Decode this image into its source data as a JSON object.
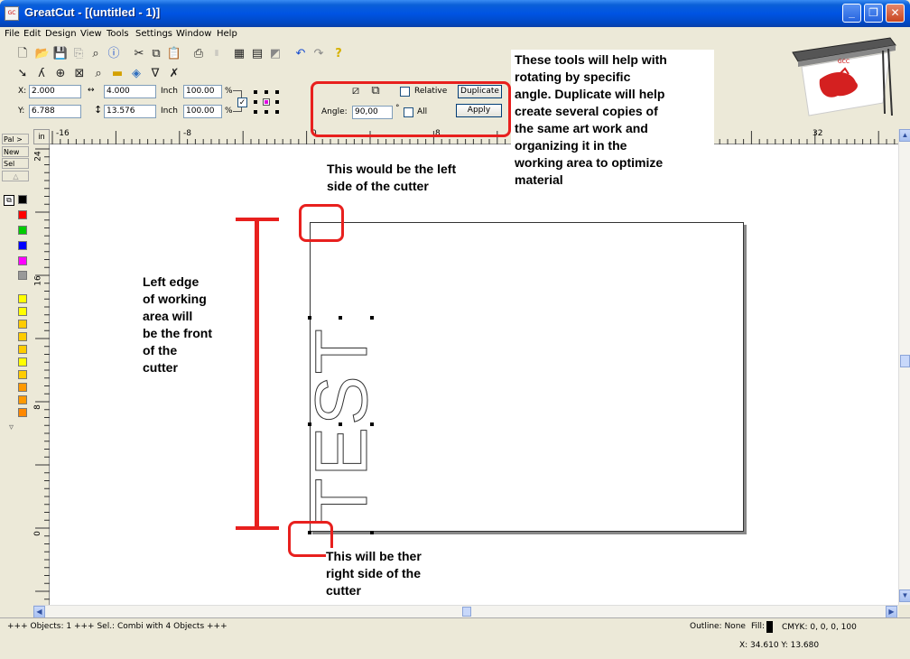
{
  "window": {
    "app_name": "GreatCut",
    "doc_title": " - [(untitled - 1)]",
    "icon_text": "GC"
  },
  "menu": [
    "File",
    "Edit",
    "Design",
    "View",
    "Tools",
    "Settings",
    "Window",
    "Help"
  ],
  "toolbar_icons": {
    "row1": [
      "new-file-icon",
      "open-folder-icon",
      "save-icon",
      "export-icon",
      "preview-icon",
      "info-icon",
      "cut-icon",
      "copy-icon",
      "paste-icon",
      "print-icon",
      "barcode-icon",
      "import-icon",
      "clipboard-icon",
      "erase-icon",
      "undo-icon",
      "redo-icon",
      "help-icon"
    ],
    "row2": [
      "pointer-icon",
      "node-edit-icon",
      "crosshair-icon",
      "frame-icon",
      "zoom-icon",
      "fill-bar-icon",
      "bucket-icon",
      "weld-icon",
      "knife-icon"
    ]
  },
  "props": {
    "x_label": "X:",
    "x_value": "2.000",
    "y_label": "Y:",
    "y_value": "6.788",
    "width_value": "4.000",
    "height_value": "13.576",
    "unit_1": "Inch",
    "unit_2": "Inch",
    "scale_x": "100.00",
    "scale_y": "100.00",
    "pct_1": "%",
    "pct_2": "%",
    "relative_label": "Relative",
    "duplicate_label": "Duplicate",
    "angle_label": "Angle:",
    "angle_value": "90,00",
    "degree": "°",
    "all_label": "All",
    "apply_label": "Apply"
  },
  "rulers": {
    "unit": "in",
    "h_ticks": [
      "-16",
      "-8",
      "0",
      "8",
      "32"
    ],
    "v_ticks": [
      "24",
      "16",
      "8",
      "0"
    ]
  },
  "palette": {
    "pal_label": "Pal >",
    "new_label": "New",
    "sel_label": "Sel",
    "colors": [
      "#000000",
      "#ff0000",
      "#00cc00",
      "#0000ff",
      "#ff00ff",
      "#999999",
      "#ffff00",
      "#ffff00",
      "#ffcc00",
      "#ffcc00",
      "#ffcc00",
      "#ffff00",
      "#ffcc00",
      "#ff9900",
      "#ff9900",
      "#ff8800"
    ]
  },
  "canvas": {
    "design_text": "TEST"
  },
  "annotations": {
    "tools_note": "These tools will help with\nrotating by specific\nangle. Duplicate will help\ncreate several copies of\nthe same art work and\norganizing it in the\nworking area to optimize\nmaterial",
    "left_side_note": "This would be the left\nside of the cutter",
    "left_edge_note": "Left edge\nof working\narea  will\nbe the front\nof the\ncutter",
    "right_side_note": "This will be ther\nright side of the\ncutter"
  },
  "status": {
    "objects": "+++ Objects: 1 +++ Sel.: Combi with 4 Objects +++",
    "outline": "Outline: None",
    "fill_label": "Fill:",
    "fill_value": "CMYK: 0, 0, 0, 100",
    "coords": "X: 34.610 Y: 13.680"
  },
  "colors": {
    "accent_red": "#e8201e",
    "titlebar_blue": "#0054e3"
  }
}
